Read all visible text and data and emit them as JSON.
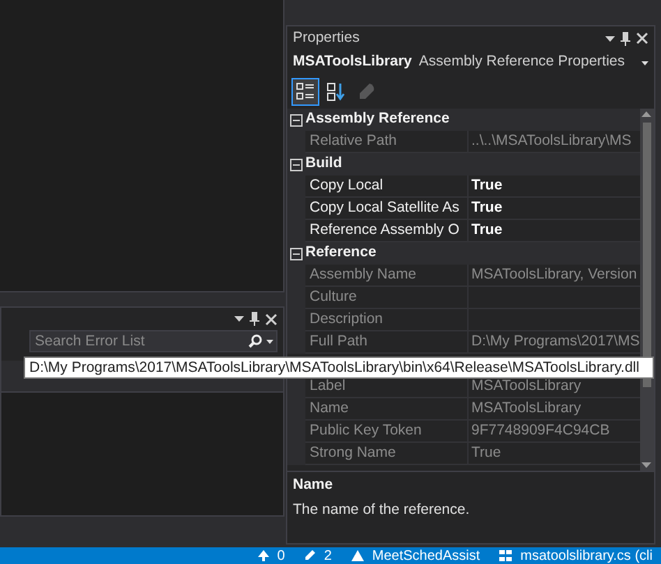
{
  "error_list": {
    "search": {
      "placeholder": "Search Error List"
    }
  },
  "properties": {
    "title": "Properties",
    "object_name": "MSAToolsLibrary",
    "object_type": "Assembly Reference Properties",
    "toolbar": [
      {
        "kind": "categorized",
        "selected": true,
        "disabled": false
      },
      {
        "kind": "alphabetical",
        "selected": false,
        "disabled": false
      },
      {
        "kind": "pages",
        "selected": false,
        "disabled": true
      }
    ],
    "categories": [
      {
        "name": "Assembly Reference",
        "expanded": true,
        "items": [
          {
            "name": "Relative Path",
            "value": "..\\..\\MSAToolsLibrary\\MS",
            "readonly": true,
            "bold": false
          }
        ]
      },
      {
        "name": "Build",
        "expanded": true,
        "items": [
          {
            "name": "Copy Local",
            "value": "True",
            "readonly": false,
            "bold": true
          },
          {
            "name": "Copy Local Satellite As",
            "value": "True",
            "readonly": false,
            "bold": true
          },
          {
            "name": "Reference Assembly O",
            "value": "True",
            "readonly": false,
            "bold": true
          }
        ]
      },
      {
        "name": "Reference",
        "expanded": true,
        "items": [
          {
            "name": "Assembly Name",
            "value": "MSAToolsLibrary, Version",
            "readonly": true,
            "bold": false
          },
          {
            "name": "Culture",
            "readonly": true,
            "bold": false
          },
          {
            "name": "Description",
            "readonly": true,
            "bold": false
          },
          {
            "name": "Full Path",
            "value": "D:\\My Programs\\2017\\MS",
            "readonly": true,
            "bold": false,
            "tooltip": "D:\\My Programs\\2017\\MSAToolsLibrary\\MSAToolsLibrary\\bin\\x64\\Release\\MSAToolsLibrary.dll"
          },
          {
            "name": "Label",
            "value": "MSAToolsLibrary",
            "readonly": true,
            "bold": false
          },
          {
            "name": "Name",
            "value": "MSAToolsLibrary",
            "readonly": true,
            "bold": false
          },
          {
            "name": "Public Key Token",
            "value": "9F7748909F4C94CB",
            "readonly": true,
            "bold": false
          },
          {
            "name": "Strong Name",
            "value": "True",
            "readonly": true,
            "bold": false
          }
        ]
      }
    ],
    "description": {
      "title": "Name",
      "text": "The name of the reference."
    }
  },
  "status_bar": [
    {
      "kind": "up",
      "text": "0"
    },
    {
      "kind": "pencil",
      "text": "2"
    },
    {
      "kind": "repo",
      "text": "MeetSchedAssist"
    },
    {
      "kind": "branch",
      "text": "msatoolslibrary.cs (cli"
    }
  ]
}
